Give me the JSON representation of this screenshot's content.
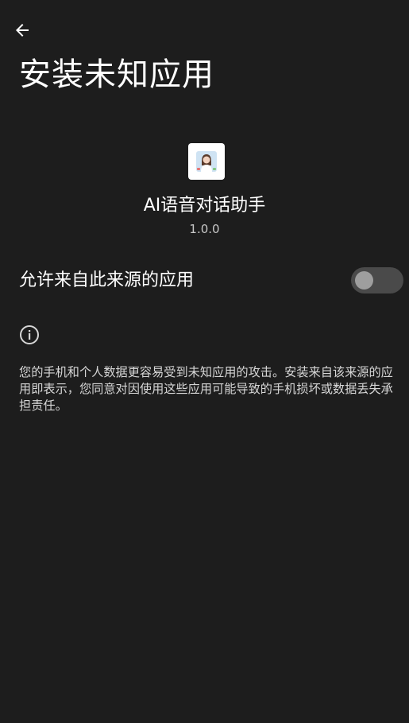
{
  "header": {
    "back_icon": "arrow-back-icon",
    "title": "安装未知应用"
  },
  "app": {
    "icon": "assistant-avatar-icon",
    "name": "AI语音对话助手",
    "version": "1.0.0"
  },
  "setting": {
    "label": "允许来自此来源的应用",
    "enabled": false
  },
  "info": {
    "icon": "info-icon",
    "text": "您的手机和个人数据更容易受到未知应用的攻击。安装来自该来源的应用即表示，您同意对因使用这些应用可能导致的手机损坏或数据丢失承担责任。"
  },
  "colors": {
    "background": "#1d1d1d",
    "toggle_track": "#4a4a4a",
    "toggle_knob": "#9e9e9e"
  }
}
